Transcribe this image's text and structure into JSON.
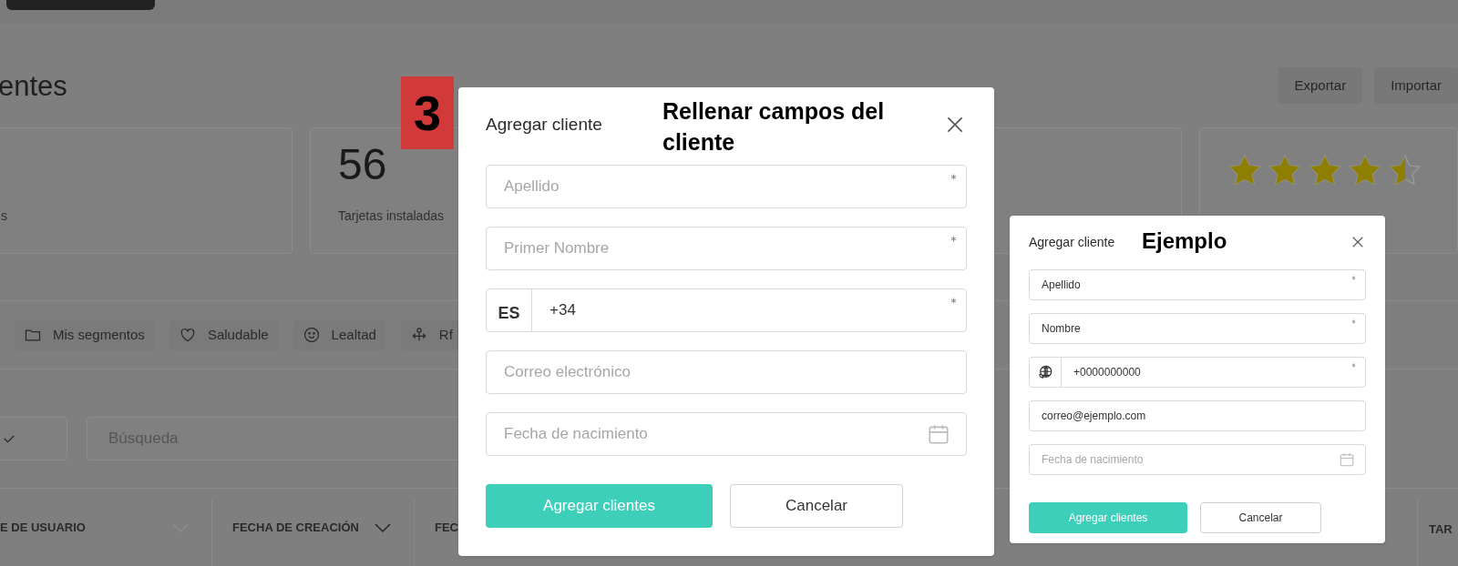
{
  "background": {
    "page_title": "entes",
    "actions": [
      {
        "label": "Exportar"
      },
      {
        "label": "Importar"
      }
    ],
    "stat_cards": [
      {
        "label": "s"
      },
      {
        "value": "56",
        "label": "Tarjetas instaladas"
      }
    ],
    "rating_card": {
      "stars": 4.5
    },
    "segments": [
      {
        "kind": "folder",
        "label": "Mis segmentos"
      },
      {
        "kind": "heart",
        "label": "Saludable"
      },
      {
        "kind": "smiley",
        "label": "Lealtad"
      },
      {
        "kind": "network",
        "label": "Rf"
      }
    ],
    "search": {
      "placeholder": "Búsqueda"
    },
    "table": {
      "columns": [
        {
          "label": "E DE USUARIO"
        },
        {
          "label": "FECHA DE CREACIÓN"
        },
        {
          "label": "FEC"
        },
        {
          "label": "TAR"
        }
      ]
    }
  },
  "step_badge": "3",
  "annotation": "Rellenar campos del cliente",
  "dialog": {
    "title": "Agregar cliente",
    "fields": [
      {
        "kind": "text",
        "placeholder": "Apellido",
        "required": true
      },
      {
        "kind": "text",
        "placeholder": "Primer Nombre",
        "required": true
      },
      {
        "kind": "phone",
        "country": "ES",
        "value": "+34",
        "required": true
      },
      {
        "kind": "text",
        "placeholder": "Correo electrónico",
        "required": false
      },
      {
        "kind": "date",
        "placeholder": "Fecha de nacimiento",
        "required": false
      }
    ],
    "buttons": [
      {
        "kind": "primary",
        "label": "Agregar clientes"
      },
      {
        "kind": "secondary",
        "label": "Cancelar"
      }
    ]
  },
  "example_label": "Ejemplo",
  "example_dialog": {
    "title": "Agregar cliente",
    "fields": [
      {
        "kind": "text",
        "value": "Apellido",
        "required": true
      },
      {
        "kind": "text",
        "value": "Nombre",
        "required": true
      },
      {
        "kind": "phone",
        "value": "+0000000000",
        "required": true
      },
      {
        "kind": "text",
        "value": "correo@ejemplo.com",
        "required": false
      },
      {
        "kind": "date",
        "placeholder": "Fecha de nacimiento",
        "required": false
      }
    ],
    "buttons": [
      {
        "kind": "primary",
        "label": "Agregar clientes"
      },
      {
        "kind": "secondary",
        "label": "Cancelar"
      }
    ]
  }
}
